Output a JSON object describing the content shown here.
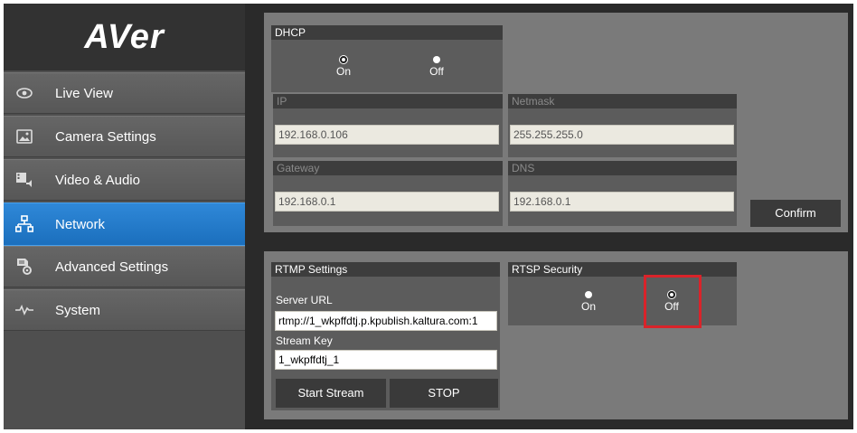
{
  "brand": {
    "logo_text": "AVer"
  },
  "sidebar": {
    "items": [
      {
        "label": "Live View",
        "icon": "eye-icon",
        "active": false
      },
      {
        "label": "Camera Settings",
        "icon": "image-icon",
        "active": false
      },
      {
        "label": "Video & Audio",
        "icon": "video-audio-icon",
        "active": false
      },
      {
        "label": "Network",
        "icon": "network-icon",
        "active": true
      },
      {
        "label": "Advanced Settings",
        "icon": "advanced-settings-icon",
        "active": false
      },
      {
        "label": "System",
        "icon": "pulse-icon",
        "active": false
      }
    ]
  },
  "network": {
    "dhcp": {
      "title": "DHCP",
      "on_label": "On",
      "off_label": "Off",
      "selected": "On"
    },
    "ip": {
      "label": "IP",
      "value": "192.168.0.106"
    },
    "netmask": {
      "label": "Netmask",
      "value": "255.255.255.0"
    },
    "gateway": {
      "label": "Gateway",
      "value": "192.168.0.1"
    },
    "dns": {
      "label": "DNS",
      "value": "192.168.0.1"
    },
    "confirm_label": "Confirm"
  },
  "rtmp": {
    "title": "RTMP Settings",
    "server_url_label": "Server URL",
    "server_url_value": "rtmp://1_wkpffdtj.p.kpublish.kaltura.com:1",
    "stream_key_label": "Stream Key",
    "stream_key_value": "1_wkpffdtj_1",
    "start_label": "Start Stream",
    "stop_label": "STOP"
  },
  "rtsp": {
    "title": "RTSP Security",
    "on_label": "On",
    "off_label": "Off",
    "selected": "Off"
  },
  "colors": {
    "active_nav": "#1f78c8",
    "highlight": "#d9232a"
  }
}
